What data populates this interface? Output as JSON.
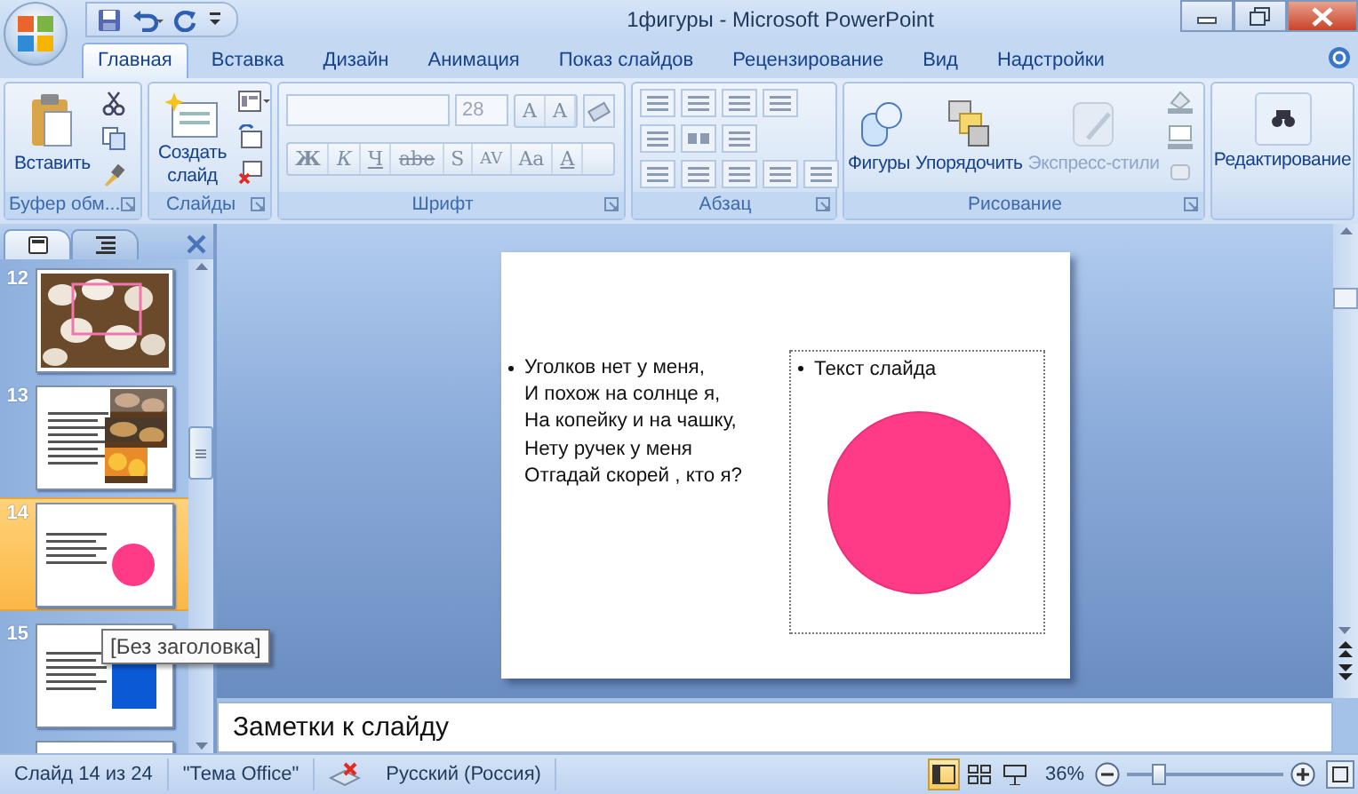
{
  "window": {
    "title": "1фигуры - Microsoft PowerPoint"
  },
  "tabs": [
    {
      "label": "Главная",
      "selected": true
    },
    {
      "label": "Вставка",
      "selected": false
    },
    {
      "label": "Дизайн",
      "selected": false
    },
    {
      "label": "Анимация",
      "selected": false
    },
    {
      "label": "Показ слайдов",
      "selected": false
    },
    {
      "label": "Рецензирование",
      "selected": false
    },
    {
      "label": "Вид",
      "selected": false
    },
    {
      "label": "Надстройки",
      "selected": false
    }
  ],
  "ribbon": {
    "groups": [
      {
        "kind": "clipboard",
        "label": "Буфер обм...",
        "commands": [
          {
            "label": "Вставить"
          }
        ]
      },
      {
        "kind": "slides",
        "label": "Слайды",
        "commands": [
          {
            "label": "Создать\nслайд"
          }
        ]
      },
      {
        "kind": "font",
        "label": "Шрифт",
        "font_size": "28",
        "size_buttons": [
          "A",
          "A"
        ],
        "format_buttons": [
          "Ж",
          "К",
          "Ч",
          "abe",
          "S",
          "AV",
          "Aa",
          "A"
        ]
      },
      {
        "kind": "paragraph",
        "label": "Абзац"
      },
      {
        "kind": "drawing",
        "label": "Рисование",
        "commands": [
          {
            "label": "Фигуры",
            "disabled": false
          },
          {
            "label": "Упорядочить",
            "disabled": false
          },
          {
            "label": "Экспресс-стили",
            "disabled": true
          }
        ]
      },
      {
        "kind": "editing",
        "commands": [
          {
            "label": "Редактирование"
          }
        ]
      }
    ]
  },
  "slides_pane": {
    "slides": [
      {
        "number": "12",
        "selected": false
      },
      {
        "number": "13",
        "kind": "text_photos",
        "selected": false
      },
      {
        "number": "14",
        "kind": "circle",
        "selected": true
      },
      {
        "number": "15",
        "kind": "square",
        "selected": false
      },
      {
        "kind": "blank",
        "selected": false
      }
    ],
    "tooltip": "[Без заголовка]"
  },
  "slide": {
    "body": "Уголков нет у меня,\nИ похож на солнце я,\nНа копейку и на чашку,\nНету ручек у меня\nОтгадай скорей , кто я?",
    "placeholder_text": "Текст слайда"
  },
  "notes": {
    "text": "Заметки к слайду"
  },
  "status_bar": {
    "slide_info": "Слайд 14 из 24",
    "theme": "\"Тема Office\"",
    "language": "Русский (Россия)",
    "views": [
      {
        "kind": "normal",
        "selected": true
      },
      {
        "kind": "sorter",
        "selected": false
      },
      {
        "kind": "show",
        "selected": false
      }
    ],
    "zoom": "36%",
    "zoom_slider": {
      "level": 0.2
    }
  }
}
